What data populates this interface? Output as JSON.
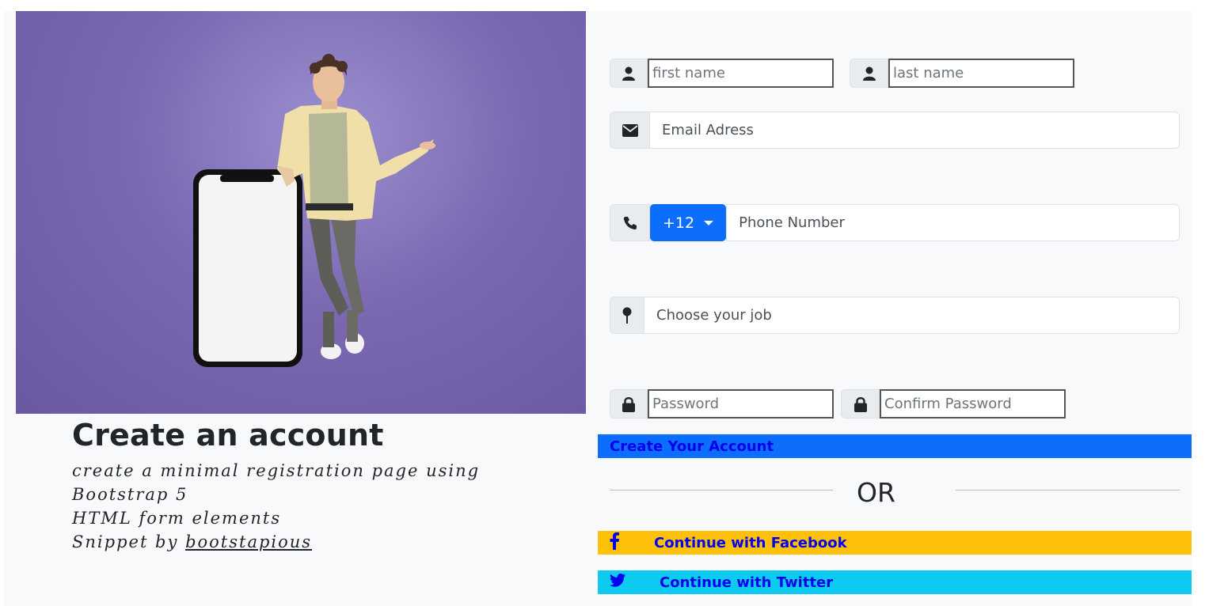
{
  "intro": {
    "title": "Create an account",
    "lines": [
      "create a minimal registration page using",
      "Bootstrap 5",
      "HTML form elements"
    ],
    "credit_prefix": "Snippet by",
    "credit_link": "bootstapious"
  },
  "form": {
    "first_name": {
      "placeholder": "first name",
      "icon": "user-icon"
    },
    "last_name": {
      "placeholder": "last name",
      "icon": "user-icon"
    },
    "email": {
      "placeholder": "Email Adress",
      "icon": "envelope-icon"
    },
    "phone": {
      "placeholder": "Phone Number",
      "icon": "phone-icon",
      "country_code": "+12"
    },
    "job": {
      "placeholder": "Choose your job",
      "icon": "map-pin-icon"
    },
    "password": {
      "placeholder": "Password",
      "icon": "lock-icon"
    },
    "confirm_password": {
      "placeholder": "Confirm Password",
      "icon": "lock-icon"
    },
    "submit_label": "Create Your Account",
    "or_label": "OR",
    "facebook_label": "Continue with Facebook",
    "twitter_label": "Continue with Twitter"
  },
  "colors": {
    "primary": "#0d6efd",
    "facebook": "#ffc107",
    "twitter": "#0dcaf0",
    "link_text": "#0000ee",
    "hero_purple": "#7a68b0"
  }
}
